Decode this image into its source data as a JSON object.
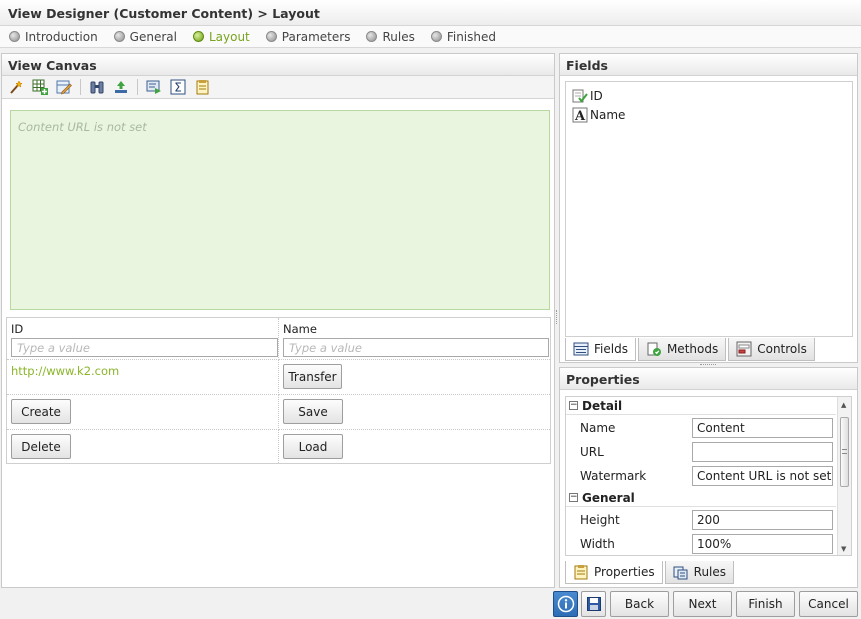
{
  "title": "View Designer (Customer Content) > Layout",
  "wizard_steps": [
    {
      "label": "Introduction",
      "active": false
    },
    {
      "label": "General",
      "active": false
    },
    {
      "label": "Layout",
      "active": true
    },
    {
      "label": "Parameters",
      "active": false
    },
    {
      "label": "Rules",
      "active": false
    },
    {
      "label": "Finished",
      "active": false
    }
  ],
  "canvas": {
    "header": "View Canvas",
    "toolbar_icons": [
      "wand-icon",
      "insert-table-icon",
      "edit-table-icon",
      "binoculars-icon",
      "upload-icon",
      "render-icon",
      "sigma-icon",
      "notes-icon"
    ],
    "content_watermark": "Content URL is not set",
    "grid": {
      "id_label": "ID",
      "name_label": "Name",
      "id_placeholder": "Type a value",
      "name_placeholder": "Type a value",
      "link_text": "http://www.k2.com",
      "transfer_label": "Transfer",
      "create_label": "Create",
      "save_label": "Save",
      "delete_label": "Delete",
      "load_label": "Load"
    }
  },
  "fields": {
    "header": "Fields",
    "items": [
      {
        "label": "ID",
        "icon": "id-field-icon"
      },
      {
        "label": "Name",
        "icon": "text-field-icon"
      }
    ],
    "tabs": [
      {
        "label": "Fields",
        "icon": "fields-tab-icon",
        "active": true
      },
      {
        "label": "Methods",
        "icon": "methods-tab-icon",
        "active": false
      },
      {
        "label": "Controls",
        "icon": "controls-tab-icon",
        "active": false
      }
    ]
  },
  "properties": {
    "header": "Properties",
    "sections": [
      {
        "title": "Detail",
        "rows": [
          {
            "label": "Name",
            "value": "Content"
          },
          {
            "label": "URL",
            "value": ""
          },
          {
            "label": "Watermark",
            "value": "Content URL is not set"
          }
        ]
      },
      {
        "title": "General",
        "rows": [
          {
            "label": "Height",
            "value": "200"
          },
          {
            "label": "Width",
            "value": "100%"
          }
        ]
      }
    ],
    "tabs": [
      {
        "label": "Properties",
        "icon": "properties-tab-icon",
        "active": true
      },
      {
        "label": "Rules",
        "icon": "rules-tab-icon",
        "active": false
      }
    ]
  },
  "footer": {
    "info_icon": "info-icon",
    "save_icon": "save-disk-icon",
    "back_label": "Back",
    "next_label": "Next",
    "finish_label": "Finish",
    "cancel_label": "Cancel"
  },
  "colors": {
    "active_step": "#7aa31f",
    "content_bg": "#eaf5e0",
    "link": "#8ab52a",
    "info_button": "#2d6db5"
  }
}
